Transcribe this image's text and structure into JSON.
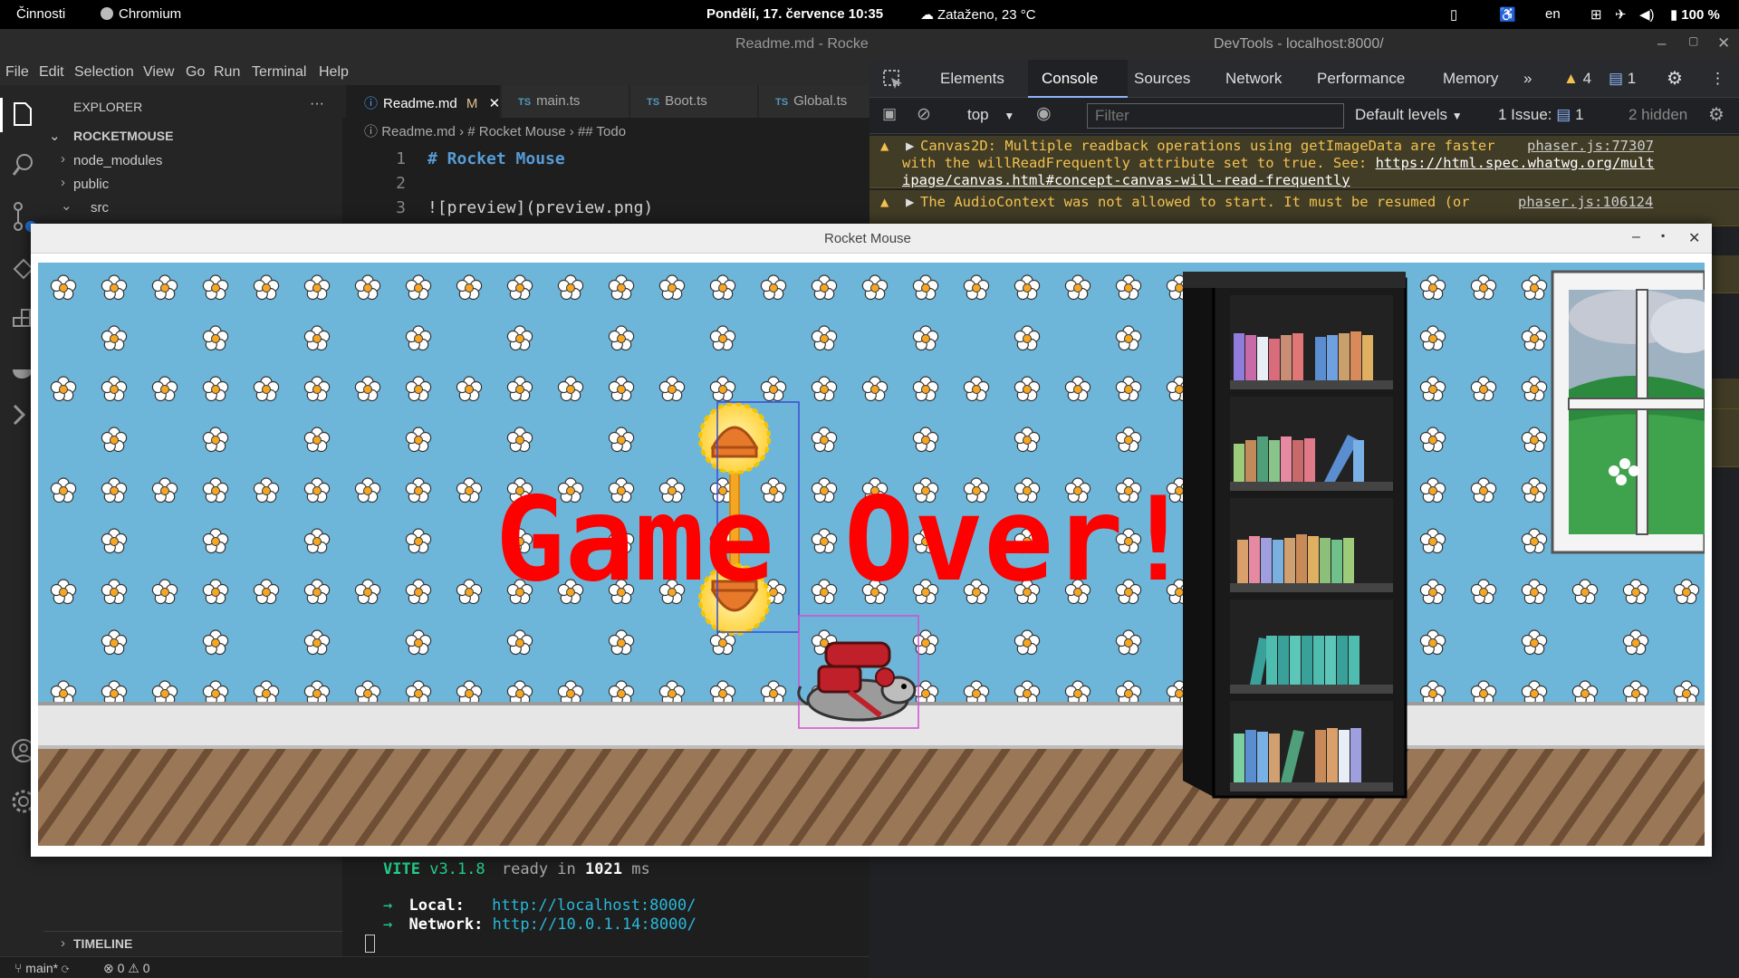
{
  "topbar": {
    "activities": "Činnosti",
    "app": "Chromium",
    "datetime": "Pondělí, 17. července  10:35",
    "weather": "Zataženo, 23 °C",
    "lang": "en",
    "battery": "100 %"
  },
  "vscode": {
    "title": "Readme.md - Rocke",
    "menu": [
      "File",
      "Edit",
      "Selection",
      "View",
      "Go",
      "Run",
      "Terminal",
      "Help"
    ],
    "explorer_title": "EXPLORER",
    "explorer_more": "···",
    "project": "ROCKETMOUSE",
    "tree": [
      "node_modules",
      "public",
      "src"
    ],
    "tabs": [
      {
        "label": "Readme.md",
        "badge": "M"
      },
      {
        "label": "main.ts"
      },
      {
        "label": "Boot.ts"
      },
      {
        "label": "Global.ts"
      }
    ],
    "breadcrumb": [
      "Readme.md",
      "# Rocket Mouse",
      "## Todo"
    ],
    "lines": [
      {
        "n": "1",
        "text": "# Rocket Mouse"
      },
      {
        "n": "2",
        "text": ""
      },
      {
        "n": "3",
        "text": "![preview](preview.png)"
      }
    ],
    "timeline": "TIMELINE",
    "branch": "main*",
    "problems": "⊗ 0 ⚠ 0"
  },
  "terminal": {
    "vite": "VITE",
    "version": "v3.1.8",
    "ready": "ready in",
    "ms_value": "1021",
    "ms": "ms",
    "local_label": "Local:",
    "local_url": "http://localhost:8000/",
    "network_label": "Network:",
    "network_url": "http://10.0.1.14:8000/"
  },
  "devtools": {
    "title": "DevTools - localhost:8000/",
    "tabs": [
      "Elements",
      "Console",
      "Sources",
      "Network",
      "Performance",
      "Memory"
    ],
    "active_tab": "Console",
    "warn_count": "4",
    "msg_count": "1",
    "context": "top",
    "filter_placeholder": "Filter",
    "levels": "Default levels",
    "issues_label": "1 Issue:",
    "issues_count": "1",
    "hidden": "2 hidden",
    "messages": [
      {
        "text": "Canvas2D: Multiple readback operations using getImageData are faster",
        "text2": "with the willReadFrequently attribute set to true. See: ",
        "link": "https://html.spec.whatwg.org/mult",
        "link2": "ipage/canvas.html#concept-canvas-will-read-frequently",
        "source": "phaser.js:77307"
      },
      {
        "text": "The AudioContext was not allowed to start. It must be resumed (or",
        "source": "phaser.js:106124"
      }
    ]
  },
  "game": {
    "window_title": "Rocket Mouse",
    "game_over_text": "Game Over!",
    "colors": {
      "wallpaper": "#6db6d9",
      "floor": "#8c6b4f",
      "baseboard": "#e6e6e6",
      "game_over": "#ff0000"
    }
  }
}
